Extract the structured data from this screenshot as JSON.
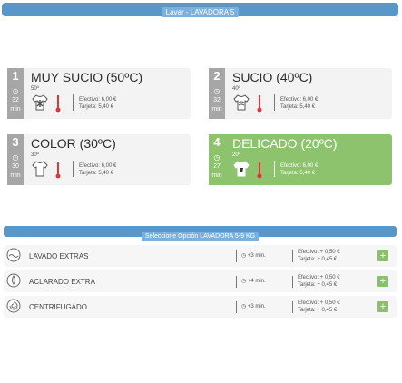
{
  "header": {
    "title": "Lavar - LAVADORA 5"
  },
  "programs": [
    {
      "number": "1",
      "name": "MUY SUCIO (50ºC)",
      "temp": "50º",
      "minutes": "32",
      "unit": "min",
      "effective": "Efectivo: 6,00 €",
      "card": "Tarjeta: 5,40 €",
      "selected": false
    },
    {
      "number": "2",
      "name": "SUCIO (40ºC)",
      "temp": "40º",
      "minutes": "32",
      "unit": "min",
      "effective": "Efectivo: 6,00 €",
      "card": "Tarjeta: 5,40 €",
      "selected": false
    },
    {
      "number": "3",
      "name": "COLOR (30ºC)",
      "temp": "30º",
      "minutes": "30",
      "unit": "min",
      "effective": "Efectivo: 6,00 €",
      "card": "Tarjeta: 5,40 €",
      "selected": false
    },
    {
      "number": "4",
      "name": "DELICADO (20ºC)",
      "temp": "20º",
      "minutes": "27",
      "unit": "min",
      "effective": "Efectivo: 6,00 €",
      "card": "Tarjeta: 5,40 €",
      "selected": true
    }
  ],
  "options_header": {
    "title": "Seleccione Opción LAVADORA 5-9 KG"
  },
  "options": [
    {
      "name": "LAVADO EXTRAS",
      "time": "+3 min.",
      "effective": "Efectivo: + 0,50 €",
      "card": "Tarjeta: + 0,45 €",
      "add": "+"
    },
    {
      "name": "ACLARADO EXTRA",
      "time": "+4 min.",
      "effective": "Efectivo: + 0,50 €",
      "card": "Tarjeta: + 0,45 €",
      "add": "+"
    },
    {
      "name": "CENTRIFUGADO",
      "time": "+3 min.",
      "effective": "Efectivo: + 0,50 €",
      "card": "Tarjeta: + 0,45 €",
      "add": "+"
    }
  ],
  "icons": {
    "clock": "◷"
  },
  "colors": {
    "accent_blue": "#5a97c9",
    "selected_green": "#8dc36c",
    "badge_gray": "#a6a6a6"
  }
}
